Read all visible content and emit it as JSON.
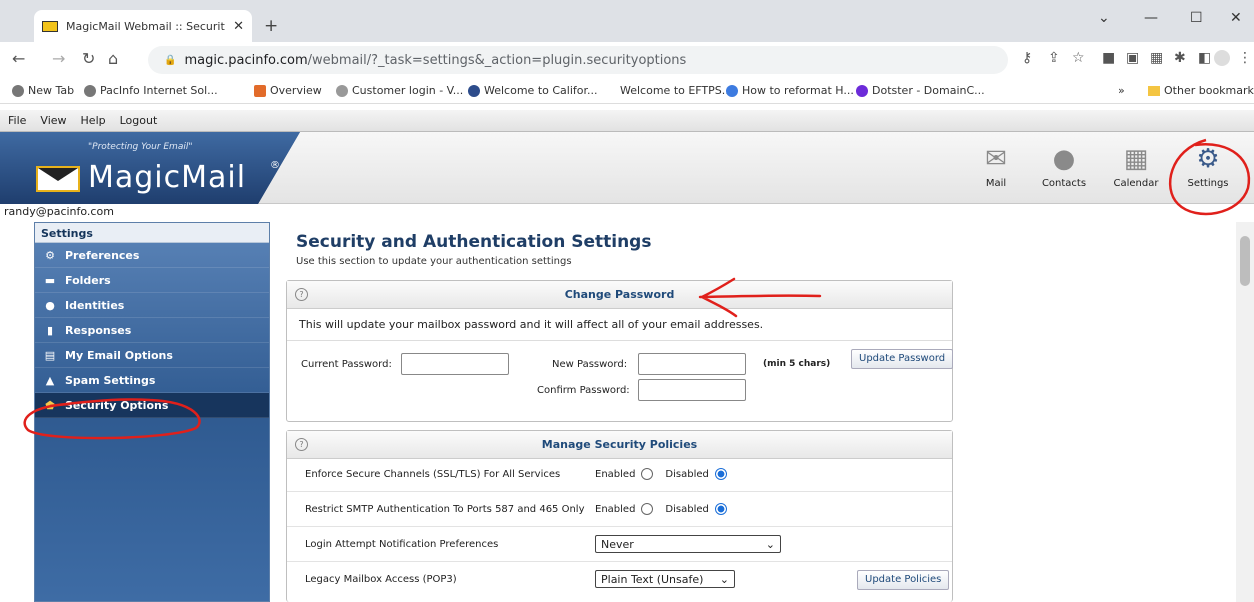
{
  "browser": {
    "tab_title": "MagicMail Webmail :: Security Op",
    "new_tab": "+",
    "url_host": "magic.pacinfo.com",
    "url_path": "/webmail/?_task=settings&_action=plugin.securityoptions",
    "bookmarks": [
      "New Tab",
      "PacInfo Internet Sol...",
      "Overview",
      "Customer login - V...",
      "Welcome to Califor...",
      "Welcome to EFTPS...",
      "How to reformat H...",
      "Dotster - DomainC..."
    ],
    "other_bookmarks": "Other bookmarks",
    "bookmark_more": "»"
  },
  "menu": [
    "File",
    "View",
    "Help",
    "Logout"
  ],
  "logo": {
    "tagline": "\"Protecting Your Email\"",
    "name": "MagicMail",
    "reg": "®"
  },
  "appnav": [
    {
      "label": "Mail",
      "icon": "mail-icon"
    },
    {
      "label": "Contacts",
      "icon": "contacts-icon"
    },
    {
      "label": "Calendar",
      "icon": "calendar-icon"
    },
    {
      "label": "Settings",
      "icon": "gear-icon"
    }
  ],
  "user_email": "randy@pacinfo.com",
  "sidebar": {
    "title": "Settings",
    "items": [
      {
        "label": "Preferences",
        "icon": "gears-icon"
      },
      {
        "label": "Folders",
        "icon": "folder-icon"
      },
      {
        "label": "Identities",
        "icon": "person-icon"
      },
      {
        "label": "Responses",
        "icon": "document-icon"
      },
      {
        "label": "My Email Options",
        "icon": "email-options-icon"
      },
      {
        "label": "Spam Settings",
        "icon": "warning-icon"
      },
      {
        "label": "Security Options",
        "icon": "shield-icon"
      }
    ]
  },
  "main": {
    "title": "Security and Authentication Settings",
    "subtitle": "Use this section to update your authentication settings",
    "change_password": {
      "heading": "Change Password",
      "description": "This will update your mailbox password and it will affect all of your email addresses.",
      "current_label": "Current Password:",
      "new_label": "New Password:",
      "confirm_label": "Confirm Password:",
      "hint": "(min 5 chars)",
      "button": "Update Password"
    },
    "policies": {
      "heading": "Manage Security Policies",
      "enabled": "Enabled",
      "disabled": "Disabled",
      "rows": [
        {
          "label": "Enforce Secure Channels (SSL/TLS) For All Services"
        },
        {
          "label": "Restrict SMTP Authentication To Ports 587 and 465 Only"
        },
        {
          "label": "Login Attempt Notification Preferences",
          "value": "Never"
        },
        {
          "label": "Legacy Mailbox Access (POP3)",
          "value": "Plain Text (Unsafe)"
        }
      ],
      "button": "Update Policies"
    }
  },
  "colors": {
    "annotation": "#e0201b",
    "sidebar": "#2f5a90",
    "accent": "#1f4a7a"
  }
}
